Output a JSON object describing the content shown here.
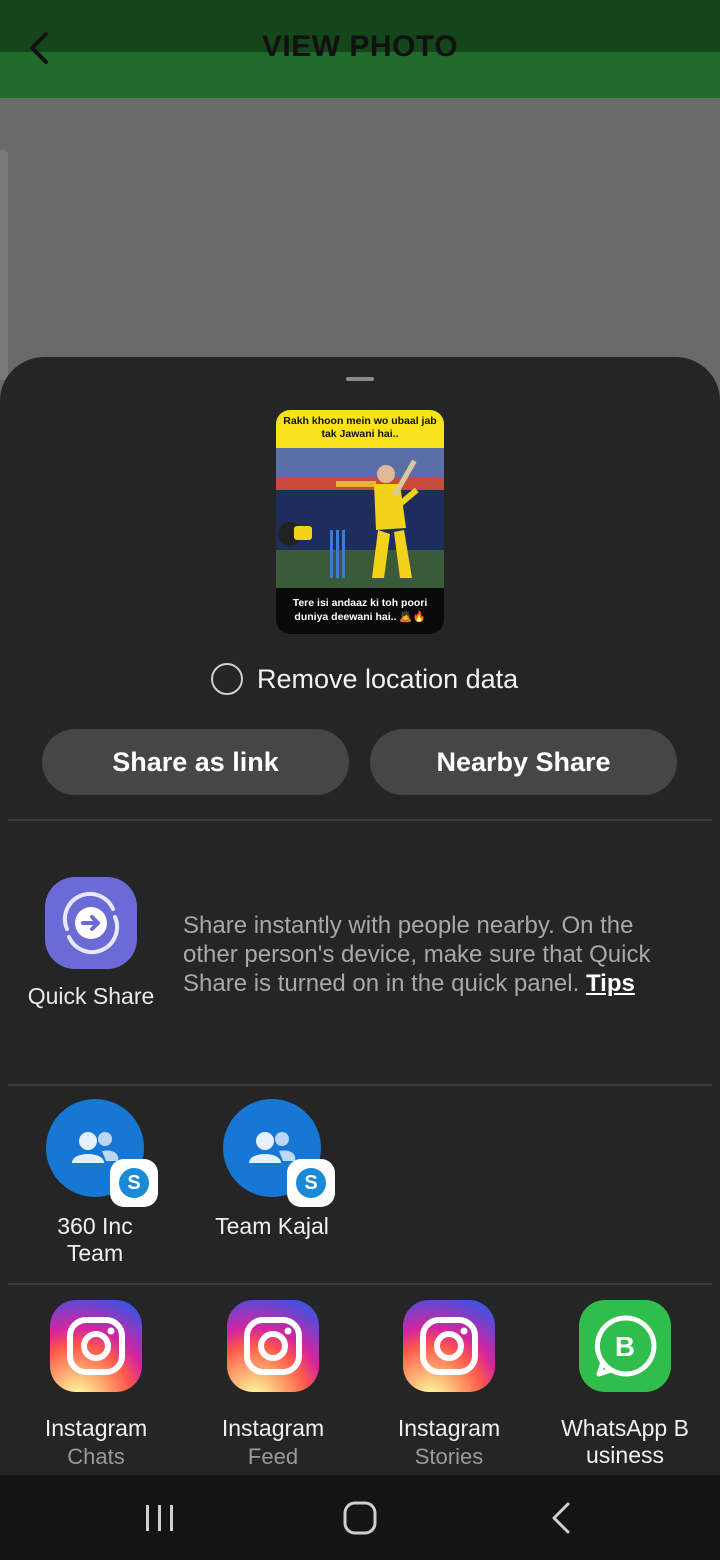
{
  "app_bar": {
    "title": "VIEW PHOTO"
  },
  "preview": {
    "top_caption": "Rakh khoon mein wo ubaal jab tak Jawani hai..",
    "bottom_caption": "Tere isi andaaz ki toh poori duniya deewani hai.. 🙇🔥"
  },
  "share_sheet": {
    "remove_location_label": "Remove location data",
    "share_as_link_label": "Share as link",
    "nearby_share_label": "Nearby Share",
    "quick_share": {
      "label": "Quick Share",
      "description": "Share instantly with people nearby. On the other person's device, make sure that Quick Share is turned on in the quick panel. ",
      "tips_link": "Tips"
    },
    "contacts": [
      {
        "name": "360 Inc Team",
        "icon": "group-icon",
        "badge": "S"
      },
      {
        "name": "Team Kajal",
        "icon": "group-icon",
        "badge": "S"
      }
    ],
    "apps": [
      {
        "line1": "Instagram",
        "line2": "Chats",
        "icon": "instagram-icon"
      },
      {
        "line1": "Instagram",
        "line2": "Feed",
        "icon": "instagram-icon"
      },
      {
        "line1": "Instagram",
        "line2": "Stories",
        "icon": "instagram-icon"
      },
      {
        "line1": "WhatsApp B",
        "line2": "usiness",
        "icon": "whatsapp-business-icon"
      }
    ]
  },
  "colors": {
    "app_bar": "#1f6b2a",
    "sheet": "#252525",
    "pill": "#464646",
    "quick_share": "#6c6bd6",
    "contact": "#1677d4",
    "whatsapp": "#2fbe4c"
  },
  "nav_bar": {
    "icons": [
      "recents-icon",
      "home-icon",
      "back-icon"
    ]
  }
}
